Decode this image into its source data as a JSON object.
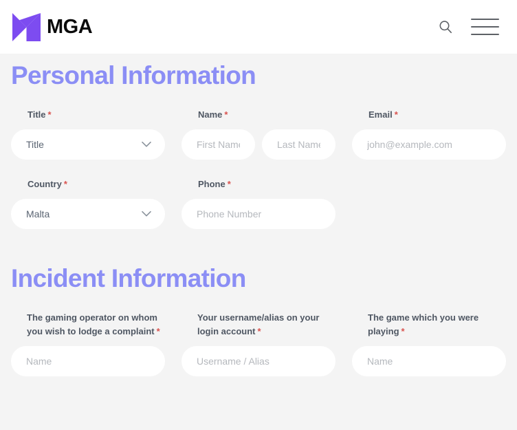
{
  "header": {
    "brand_text": "MGA",
    "brand_icon": "mga-logo-icon",
    "search_icon": "search-icon",
    "menu_icon": "hamburger-menu-icon"
  },
  "sections": [
    {
      "id": "personal",
      "title": "Personal Information",
      "rows": [
        {
          "fields": [
            {
              "label": "Title",
              "required": true,
              "type": "select",
              "value": "Title",
              "is_placeholder": true
            },
            {
              "label": "Name",
              "required": true,
              "type": "name-pair",
              "placeholder_first": "First Name",
              "placeholder_last": "Last Name"
            },
            {
              "label": "Email",
              "required": true,
              "type": "text",
              "placeholder": "john@example.com"
            }
          ]
        },
        {
          "fields": [
            {
              "label": "Country",
              "required": true,
              "type": "select",
              "value": "Malta",
              "is_placeholder": false
            },
            {
              "label": "Phone",
              "required": true,
              "type": "text",
              "placeholder": "Phone Number"
            }
          ]
        }
      ]
    },
    {
      "id": "incident",
      "title": "Incident Information",
      "rows": [
        {
          "fields": [
            {
              "label": "The gaming operator on whom you wish to lodge a complaint",
              "required": true,
              "type": "text",
              "placeholder": "Name"
            },
            {
              "label": "Your username/alias on your login account",
              "required": true,
              "type": "text",
              "placeholder": "Username / Alias"
            },
            {
              "label": "The game which you were playing",
              "required": true,
              "type": "text",
              "placeholder": "Name"
            }
          ]
        }
      ]
    }
  ],
  "colors": {
    "accent": "#7d4cf0",
    "heading": "#8b8ef5",
    "required": "#d9534f",
    "page_bg": "#f4f4f4",
    "field_bg": "#ffffff"
  }
}
